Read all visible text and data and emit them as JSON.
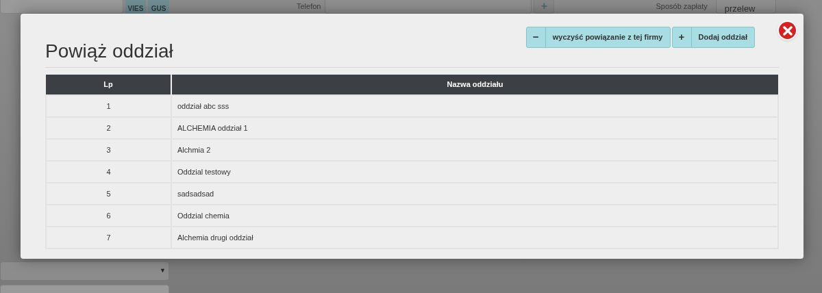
{
  "background": {
    "vies_button": "VIES",
    "gus_button": "GUS",
    "phone_label": "Telefon",
    "add_button": "+",
    "payment_label": "Sposób zapłaty",
    "payment_value": "przelew",
    "select_caret": "▼"
  },
  "dialog": {
    "title": "Powiąż oddział",
    "buttons": [
      {
        "icon": "−",
        "label": "wyczyść powiązanie z tej firmy"
      },
      {
        "icon": "+",
        "label": "Dodaj oddział"
      }
    ],
    "table": {
      "columns": [
        "Lp",
        "Nazwa oddziału"
      ],
      "rows": [
        [
          "1",
          "oddział abc sss"
        ],
        [
          "2",
          "ALCHEMIA oddział 1"
        ],
        [
          "3",
          "Alchmia 2"
        ],
        [
          "4",
          "Oddzial testowy"
        ],
        [
          "5",
          "sadsadsad"
        ],
        [
          "6",
          "Oddzial chemia"
        ],
        [
          "7",
          "Alchemia drugi oddział"
        ]
      ]
    }
  }
}
